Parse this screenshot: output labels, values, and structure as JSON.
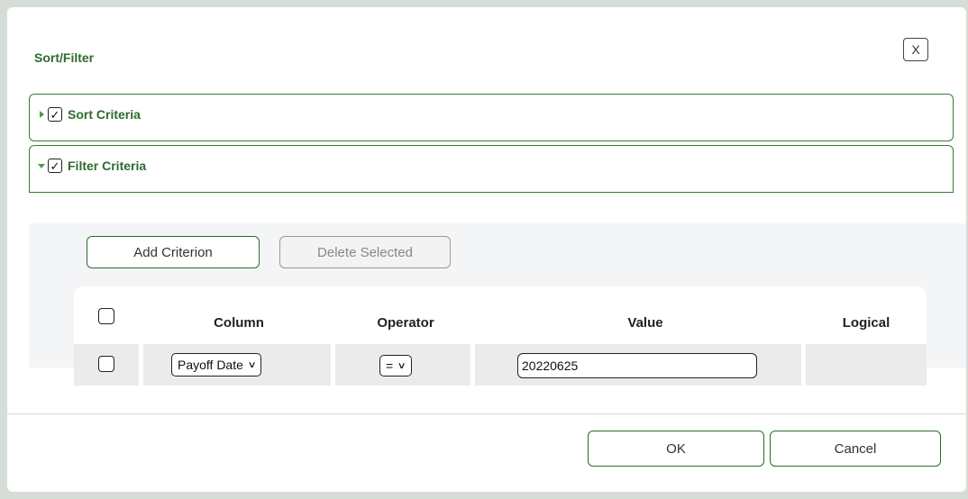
{
  "dialog": {
    "title": "Sort/Filter",
    "close_label": "X"
  },
  "sections": {
    "sort": {
      "label": "Sort Criteria",
      "checked": true,
      "expanded": false
    },
    "filter": {
      "label": "Filter Criteria",
      "checked": true,
      "expanded": true
    }
  },
  "toolbar": {
    "add_label": "Add Criterion",
    "delete_label": "Delete Selected"
  },
  "table": {
    "headers": {
      "column": "Column",
      "operator": "Operator",
      "value": "Value",
      "logical": "Logical"
    },
    "rows": [
      {
        "column": "Payoff Date",
        "operator": "=",
        "value": "20220625",
        "logical": ""
      }
    ]
  },
  "footer": {
    "ok_label": "OK",
    "cancel_label": "Cancel"
  },
  "colors": {
    "accent": "#2e6b2e",
    "panel": "#f4f5f7",
    "row": "#ebebeb"
  }
}
